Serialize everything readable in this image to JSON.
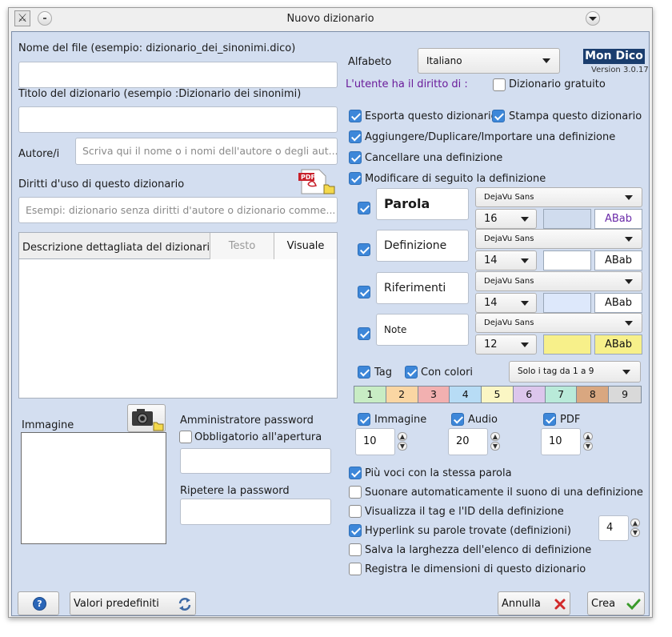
{
  "window": {
    "title": "Nuovo dizionario"
  },
  "left": {
    "file_label": "Nome del file (esempio: dizionario_dei_sinonimi.dico)",
    "file_value": "",
    "title_label": "Titolo del dizionario (esempio :Dizionario dei sinonimi)",
    "title_value": "",
    "author_label": "Autore/i",
    "author_placeholder": "Scriva qui il nome o i nomi dell'autore o degli aut...",
    "rights_label": "Diritti d'uso di questo dizionario",
    "rights_placeholder": "Esempi: dizionario senza diritti d'autore o dizionario comme...",
    "desc_label": "Descrizione dettagliata del dizionario",
    "desc_tab_text": "Testo",
    "desc_tab_visual": "Visuale",
    "image_label": "Immagine",
    "pdf_icon_text": "PDF",
    "admin_label": "Amministratore password",
    "mandatory_label": "Obbligatorio all'apertura",
    "repeat_label": "Ripetere la password"
  },
  "right": {
    "alphabet_label": "Alfabeto",
    "alphabet_value": "Italiano",
    "brand": "Mon Dico",
    "version": "Version 3.0.17",
    "rights_heading": "L'utente ha il diritto di :",
    "free_dict": "Dizionario gratuito",
    "export": "Esporta questo dizionario",
    "print": "Stampa questo dizionario",
    "add": "Aggiungere/Duplicare/Importare una definizione",
    "delete": "Cancellare una definizione",
    "modify": "Modificare di seguito la definizione",
    "fields": [
      {
        "label": "Parola",
        "font": "DejaVu Sans",
        "size": "16",
        "sample": "ABab",
        "color": "#d0dcee",
        "sample_bg": "#ffffff",
        "sample_color": "#6a2aa8"
      },
      {
        "label": "Definizione",
        "font": "DejaVu Sans",
        "size": "14",
        "sample": "ABab",
        "color": "#ffffff",
        "sample_bg": "#ffffff",
        "sample_color": "#111111"
      },
      {
        "label": "Riferimenti",
        "font": "DejaVu Sans",
        "size": "14",
        "sample": "ABab",
        "color": "#dde8fb",
        "sample_bg": "#ffffff",
        "sample_color": "#111111"
      },
      {
        "label": "Note",
        "font": "DejaVu Sans",
        "size": "12",
        "sample": "ABab",
        "color": "#f7f08a",
        "sample_bg": "#f7f08a",
        "sample_color": "#111111"
      }
    ],
    "tag_label": "Tag",
    "colors_label": "Con colori",
    "tag_filter": "Solo i tag da 1 a 9",
    "tags": [
      {
        "n": "1",
        "color": "#c8ecc4"
      },
      {
        "n": "2",
        "color": "#fad6a3"
      },
      {
        "n": "3",
        "color": "#f2b0b0"
      },
      {
        "n": "4",
        "color": "#b7dcf5"
      },
      {
        "n": "5",
        "color": "#fbf6c4"
      },
      {
        "n": "6",
        "color": "#dcc6ec"
      },
      {
        "n": "7",
        "color": "#b9ead9"
      },
      {
        "n": "8",
        "color": "#d9a780"
      },
      {
        "n": "9",
        "color": "#d9d9d9"
      }
    ],
    "image_cb": "Immagine",
    "audio_cb": "Audio",
    "pdf_cb": "PDF",
    "image_n": "10",
    "audio_n": "20",
    "pdf_n": "10",
    "opt_multi": "Più voci con la stessa parola",
    "opt_sound": "Suonare automaticamente il suono di una definizione",
    "opt_tagid": "Visualizza il tag e l'ID della definizione",
    "opt_hyper": "Hyperlink su parole trovate (definizioni)",
    "hyper_n": "4",
    "opt_width": "Salva la larghezza dell'elenco di definizione",
    "opt_dims": "Registra le dimensioni di questo dizionario"
  },
  "footer": {
    "help": "?",
    "defaults": "Valori predefiniti",
    "cancel": "Annulla",
    "create": "Crea"
  }
}
